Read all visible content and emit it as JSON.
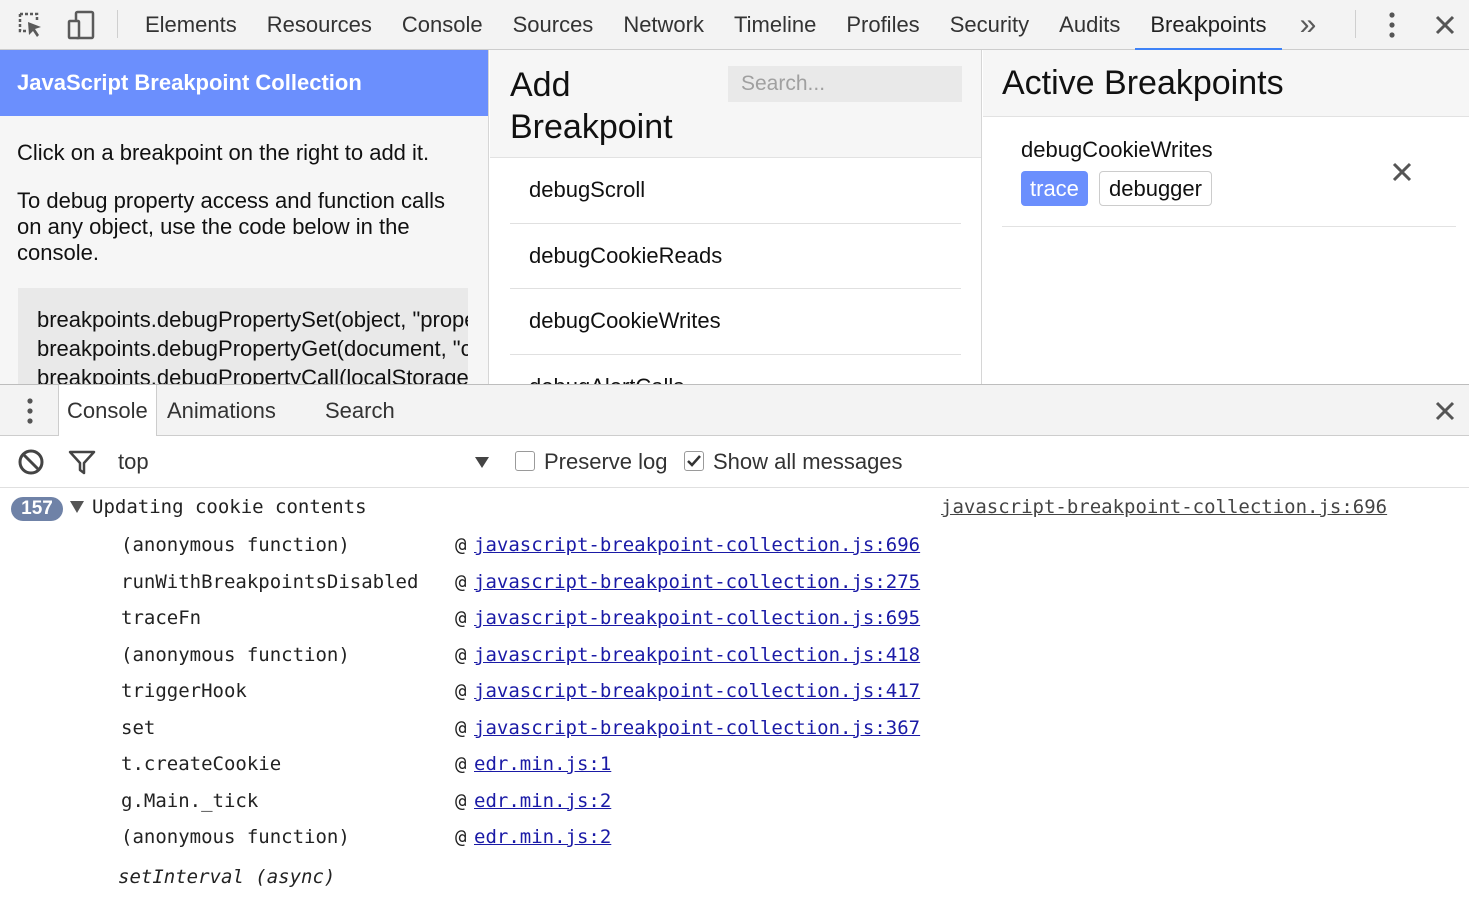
{
  "toolbar": {
    "tabs": [
      "Elements",
      "Resources",
      "Console",
      "Sources",
      "Network",
      "Timeline",
      "Profiles",
      "Security",
      "Audits",
      "Breakpoints"
    ],
    "active_tab": "Breakpoints",
    "overflow": "»"
  },
  "left_panel": {
    "title": "JavaScript Breakpoint Collection",
    "intro": "Click on a breakpoint on the right to add it.",
    "description": "To debug property access and function calls on any object, use the code below in the console.",
    "code_lines": [
      "breakpoints.debugPropertySet(object, \"propertyName\", \"trace\");",
      "breakpoints.debugPropertyGet(document, \"cookie\", \"debugger\");",
      "breakpoints.debugPropertyCall(localStorage, \"getItem\", \"trace\");"
    ]
  },
  "add_panel": {
    "title": "Add Breakpoint",
    "search_placeholder": "Search...",
    "items": [
      "debugScroll",
      "debugCookieReads",
      "debugCookieWrites",
      "debugAlertCalls"
    ]
  },
  "active_panel": {
    "title": "Active Breakpoints",
    "breakpoints": [
      {
        "name": "debugCookieWrites",
        "trace_label": "trace",
        "debugger_label": "debugger",
        "selected": "trace"
      }
    ]
  },
  "drawer": {
    "tabs": [
      "Console",
      "Animations",
      "Search"
    ],
    "active_tab": "Console",
    "context": "top",
    "preserve_log_label": "Preserve log",
    "preserve_log_checked": false,
    "show_all_label": "Show all messages",
    "show_all_checked": true
  },
  "console": {
    "count": "157",
    "message": "Updating cookie contents",
    "source": "javascript-breakpoint-collection.js:696",
    "frames": [
      {
        "fn": "(anonymous function)",
        "at": "@",
        "link": "javascript-breakpoint-collection.js:696"
      },
      {
        "fn": "runWithBreakpointsDisabled",
        "at": "@",
        "link": "javascript-breakpoint-collection.js:275"
      },
      {
        "fn": "traceFn",
        "at": "@",
        "link": "javascript-breakpoint-collection.js:695"
      },
      {
        "fn": "(anonymous function)",
        "at": "@",
        "link": "javascript-breakpoint-collection.js:418"
      },
      {
        "fn": "triggerHook",
        "at": "@",
        "link": "javascript-breakpoint-collection.js:417"
      },
      {
        "fn": "set",
        "at": "@",
        "link": "javascript-breakpoint-collection.js:367"
      },
      {
        "fn": "t.createCookie",
        "at": "@",
        "link": "edr.min.js:1"
      },
      {
        "fn": "g.Main._tick",
        "at": "@",
        "link": "edr.min.js:2"
      },
      {
        "fn": "(anonymous function)",
        "at": "@",
        "link": "edr.min.js:2"
      }
    ],
    "async_label": "setInterval (async)"
  },
  "colors": {
    "accent": "#3e82f7",
    "header_blue": "#6b8ffd",
    "badge": "#6f82a7",
    "link": "#1a1aa6"
  }
}
